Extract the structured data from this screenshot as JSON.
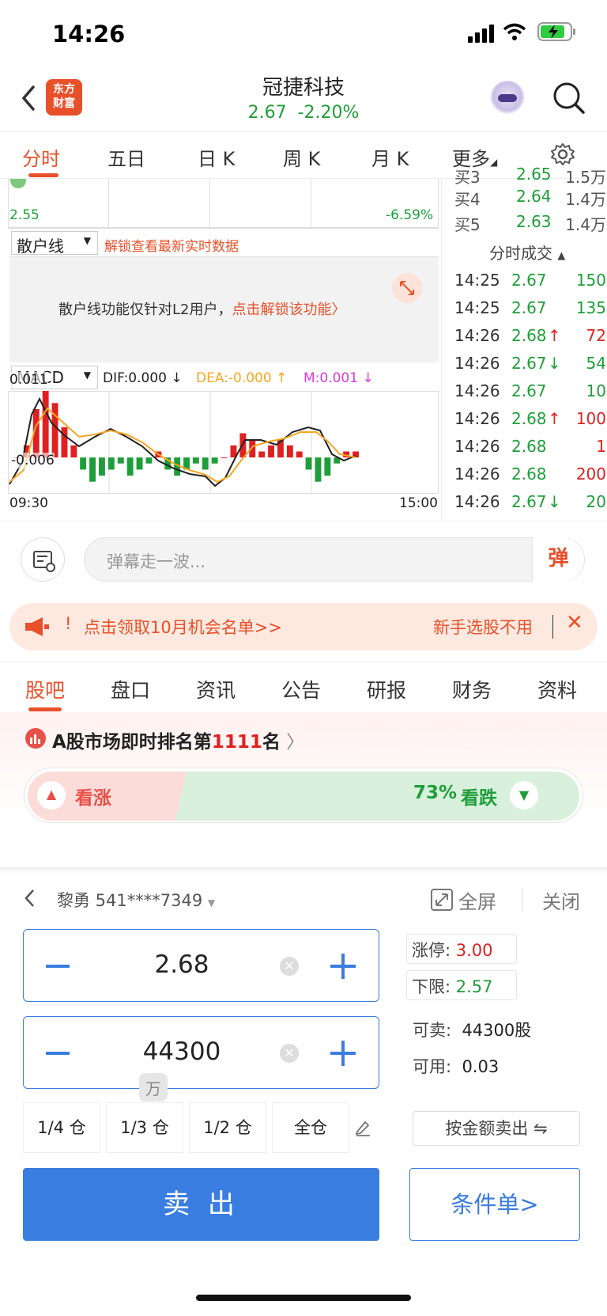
{
  "status": {
    "time": "14:26"
  },
  "header": {
    "logo_line1": "东方",
    "logo_line2": "财富",
    "name": "冠捷科技",
    "price": "2.67",
    "change": "-2.20%"
  },
  "chart_tabs": [
    "分时",
    "五日",
    "日 K",
    "周 K",
    "月 K",
    "更多"
  ],
  "chart": {
    "low_price": "2.55",
    "low_pct": "-6.59%",
    "sanhu_label": "散户线",
    "unlock_link": "解锁查看最新实时数据",
    "lock_text": "散户线功能仅针对L2用户，",
    "lock_link": "点击解锁该功能",
    "macd_label": "MACD",
    "dif": "DIF:0.000 ↓",
    "dea": "DEA:-0.000 ↑",
    "m": "M:0.001 ↓",
    "macd_top": "0.011",
    "macd_bottom": "-0.006",
    "time_start": "09:30",
    "time_end": "15:00"
  },
  "chart_data": {
    "type": "bar",
    "title": "MACD",
    "ylim": [
      -0.006,
      0.011
    ],
    "x": [
      "09:30",
      "15:00"
    ],
    "series": [
      {
        "name": "M",
        "values": [
          0.0,
          0.002,
          0.008,
          0.011,
          0.009,
          0.005,
          0.002,
          -0.002,
          -0.004,
          -0.003,
          -0.002,
          -0.001,
          -0.003,
          -0.002,
          -0.001,
          0.001,
          -0.002,
          -0.003,
          -0.002,
          -0.001,
          -0.002,
          -0.001,
          0.0,
          0.002,
          0.004,
          0.003,
          0.001,
          0.002,
          0.003,
          0.002,
          0.001,
          -0.002,
          -0.004,
          -0.003,
          -0.001,
          0.001,
          0.001
        ]
      }
    ]
  },
  "order_book": [
    {
      "label": "买3",
      "price": "2.65",
      "vol": "1.5万"
    },
    {
      "label": "买4",
      "price": "2.64",
      "vol": "1.4万"
    },
    {
      "label": "买5",
      "price": "2.63",
      "vol": "1.4万"
    }
  ],
  "trades_title": "分时成交",
  "trades": [
    {
      "time": "14:25",
      "price": "2.67",
      "arrow": "",
      "vol": "150",
      "dir": "down"
    },
    {
      "time": "14:25",
      "price": "2.67",
      "arrow": "",
      "vol": "135",
      "dir": "down"
    },
    {
      "time": "14:26",
      "price": "2.68",
      "arrow": "↑",
      "vol": "72",
      "dir": "up"
    },
    {
      "time": "14:26",
      "price": "2.67",
      "arrow": "↓",
      "vol": "54",
      "dir": "down"
    },
    {
      "time": "14:26",
      "price": "2.67",
      "arrow": "",
      "vol": "10",
      "dir": "down"
    },
    {
      "time": "14:26",
      "price": "2.68",
      "arrow": "↑",
      "vol": "100",
      "dir": "up"
    },
    {
      "time": "14:26",
      "price": "2.68",
      "arrow": "",
      "vol": "1",
      "dir": "up"
    },
    {
      "time": "14:26",
      "price": "2.68",
      "arrow": "",
      "vol": "200",
      "dir": "up"
    },
    {
      "time": "14:26",
      "price": "2.67",
      "arrow": "↓",
      "vol": "20",
      "dir": "down"
    }
  ],
  "danmu": {
    "placeholder": "弹幕走一波...",
    "button": "弹"
  },
  "banner": {
    "text": "点击领取10月机会名单>>",
    "right_text": "新手选股不用"
  },
  "content_tabs": [
    "股吧",
    "盘口",
    "资讯",
    "公告",
    "研报",
    "财务",
    "资料"
  ],
  "ranking": {
    "prefix": "A股市场即时排名第",
    "rank": "1111",
    "suffix": "名"
  },
  "sentiment": {
    "up_label": "看涨",
    "down_pct": "73%",
    "down_label": "看跌",
    "down_fraction": 0.73
  },
  "trade": {
    "account": "黎勇 541****7349",
    "fullscreen": "全屏",
    "close": "关闭",
    "price": "2.68",
    "quantity": "44300",
    "unit_hint": "万",
    "limit_up_label": "涨停:",
    "limit_up": "3.00",
    "limit_down_label": "下限:",
    "limit_down": "2.57",
    "sellable_label": "可卖:",
    "sellable": "44300股",
    "available_label": "可用:",
    "available": "0.03",
    "ratios": [
      "1/4 仓",
      "1/3 仓",
      "1/2 仓",
      "全仓"
    ],
    "by_amount": "按金额卖出 ⇋",
    "sell": "卖 出",
    "conditional": "条件单>"
  }
}
